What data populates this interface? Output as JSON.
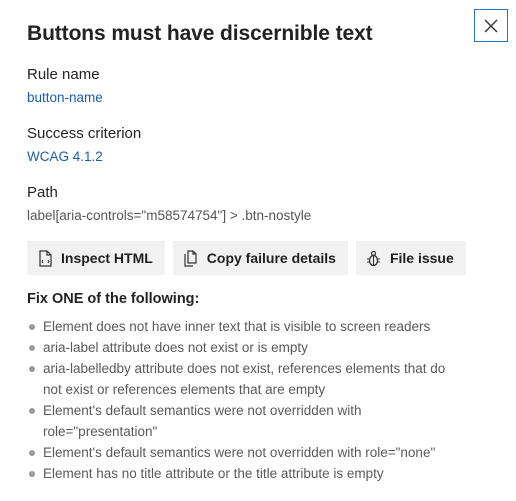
{
  "panel": {
    "title": "Buttons must have discernible text",
    "close_icon": "close-icon"
  },
  "rule": {
    "label": "Rule name",
    "value": "button-name"
  },
  "success": {
    "label": "Success criterion",
    "value": "WCAG 4.1.2"
  },
  "path": {
    "label": "Path",
    "value": "label[aria-controls=\"m58574754\"] > .btn-nostyle"
  },
  "buttons": {
    "inspect": {
      "label": "Inspect HTML",
      "icon": "inspect-html-icon"
    },
    "copy": {
      "label": "Copy failure details",
      "icon": "copy-icon"
    },
    "file": {
      "label": "File issue",
      "icon": "bug-icon"
    }
  },
  "fix": {
    "heading": "Fix ONE of the following:",
    "items": [
      "Element does not have inner text that is visible to screen readers",
      "aria-label attribute does not exist or is empty",
      "aria-labelledby attribute does not exist, references elements that do not exist or references elements that are empty",
      "Element's default semantics were not overridden with role=\"presentation\"",
      "Element's default semantics were not overridden with role=\"none\"",
      "Element has no title attribute or the title attribute is empty"
    ]
  },
  "colors": {
    "link": "#1a5ea8",
    "close_border": "#2a73c8",
    "button_bg": "#f1f1f1"
  }
}
